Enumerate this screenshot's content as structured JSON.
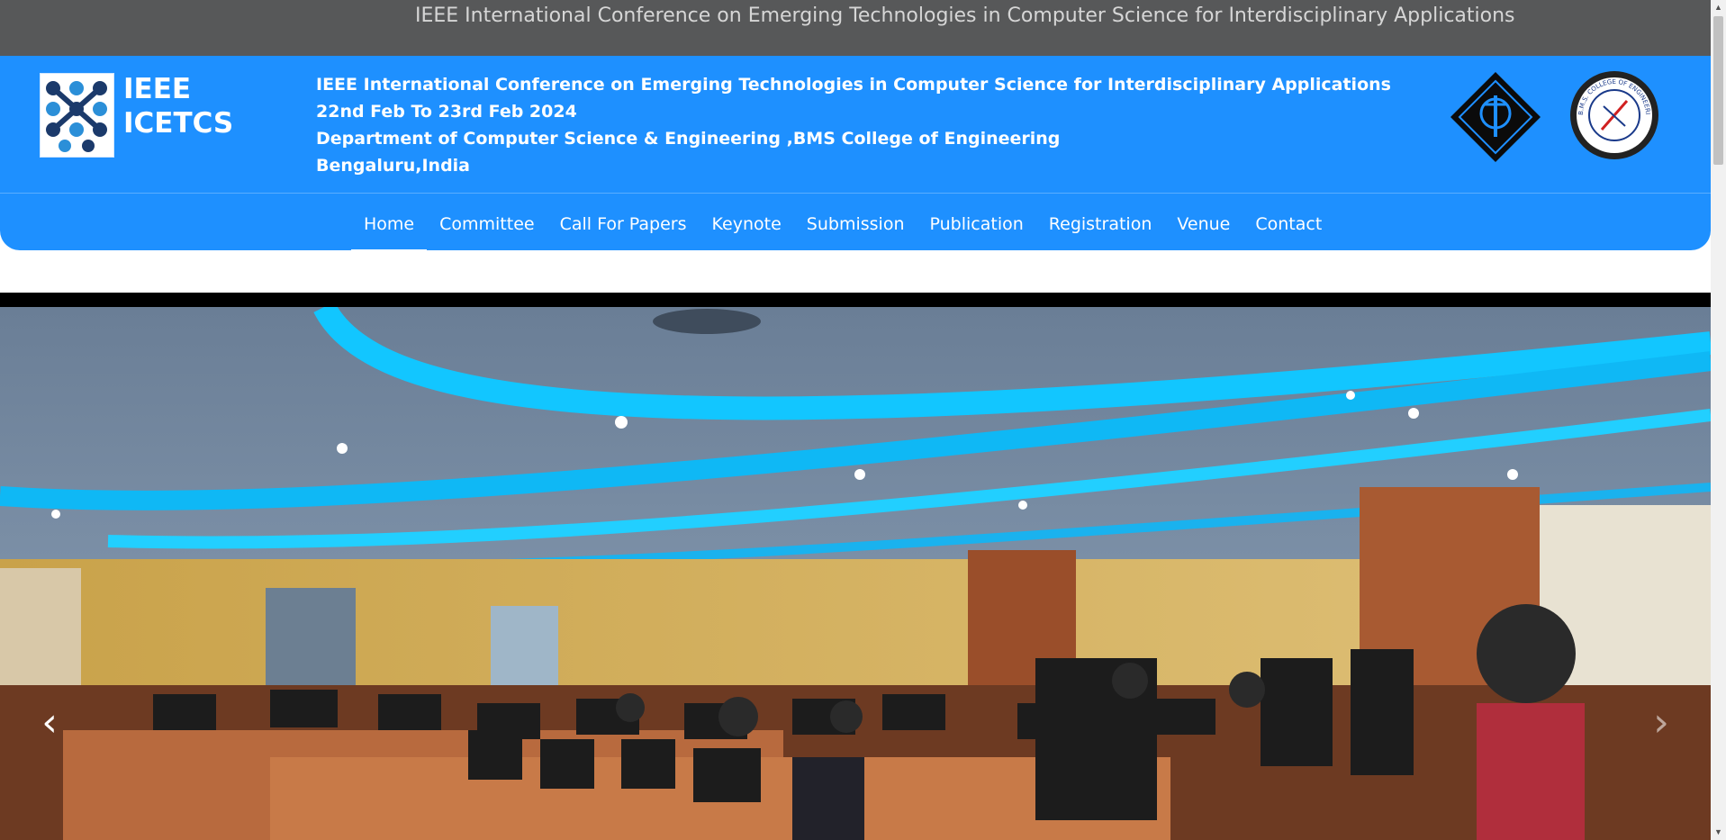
{
  "topbar": {
    "marquee_text": "IEEE International Conference on Emerging Technologies in Computer Science for Interdisciplinary Applications"
  },
  "header": {
    "brand_line1": "IEEE",
    "brand_line2": "ICETCS",
    "conference_title": "IEEE International Conference on Emerging Technologies in Computer Science for Interdisciplinary Applications",
    "dates": "22nd Feb To 23rd Feb 2024",
    "department": "Department of Computer Science & Engineering ,BMS College of Engineering",
    "location": "Bengaluru,India",
    "bms_logo_text": "B.M.S. COLLEGE OF ENGINEERING"
  },
  "nav": {
    "items": [
      {
        "label": "Home",
        "active": true
      },
      {
        "label": "Committee"
      },
      {
        "label": "Call For Papers"
      },
      {
        "label": "Keynote"
      },
      {
        "label": "Submission"
      },
      {
        "label": "Publication"
      },
      {
        "label": "Registration"
      },
      {
        "label": "Venue"
      },
      {
        "label": "Contact"
      }
    ]
  },
  "carousel": {
    "prev_icon": "‹",
    "next_icon": "›"
  },
  "colors": {
    "header_blue": "#1e90ff",
    "topbar_gray": "#575859",
    "ceiling_light": "#00c8ff",
    "wood": "#b8643a"
  }
}
